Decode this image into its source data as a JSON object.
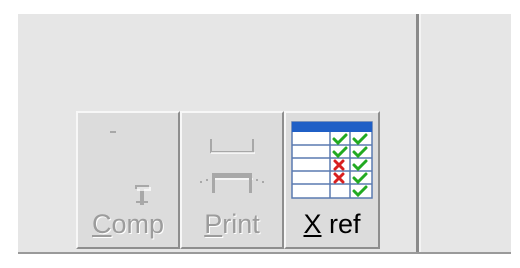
{
  "toolbar": {
    "buttons": [
      {
        "id": "comp",
        "accel": "C",
        "rest": "omp",
        "enabled": false,
        "icon": "component-icon"
      },
      {
        "id": "print",
        "accel": "P",
        "rest": "rint",
        "enabled": false,
        "icon": "printer-icon"
      },
      {
        "id": "xref",
        "accel": "X",
        "rest": " ref",
        "enabled": true,
        "icon": "cross-reference-table-icon"
      }
    ]
  },
  "colors": {
    "face": "#dcdcdc",
    "disabled_text": "#9c9c9c",
    "table_header": "#1f5fc6",
    "check": "#22aa22",
    "cross": "#d82020"
  }
}
